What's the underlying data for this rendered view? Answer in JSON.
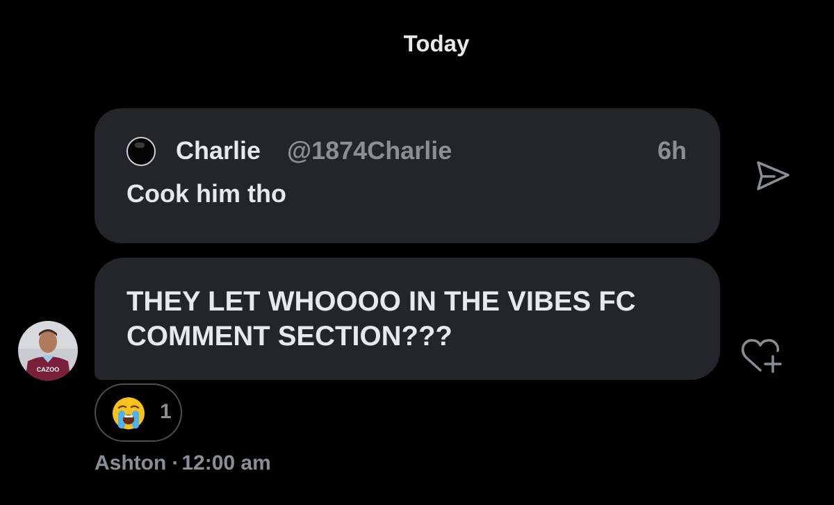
{
  "date_header": "Today",
  "quoted_post": {
    "author_name": "Charlie",
    "author_handle": "@1874Charlie",
    "time": "6h",
    "text": "Cook him tho",
    "share_icon": "share-arrow-icon"
  },
  "message": {
    "text": "THEY LET WHOOOO IN THE VIBES FC COMMENT SECTION???",
    "avatar_text": "CAZOO",
    "react_icon": "heart-plus-icon"
  },
  "reaction": {
    "emoji": "loudly-crying-face",
    "count": "1"
  },
  "meta": {
    "sender": "Ashton",
    "separator": "·",
    "time": "12:00 am"
  },
  "colors": {
    "background": "#000000",
    "bubble": "#242528",
    "text_primary": "#e7e9ea",
    "text_secondary": "#8b8f94"
  }
}
